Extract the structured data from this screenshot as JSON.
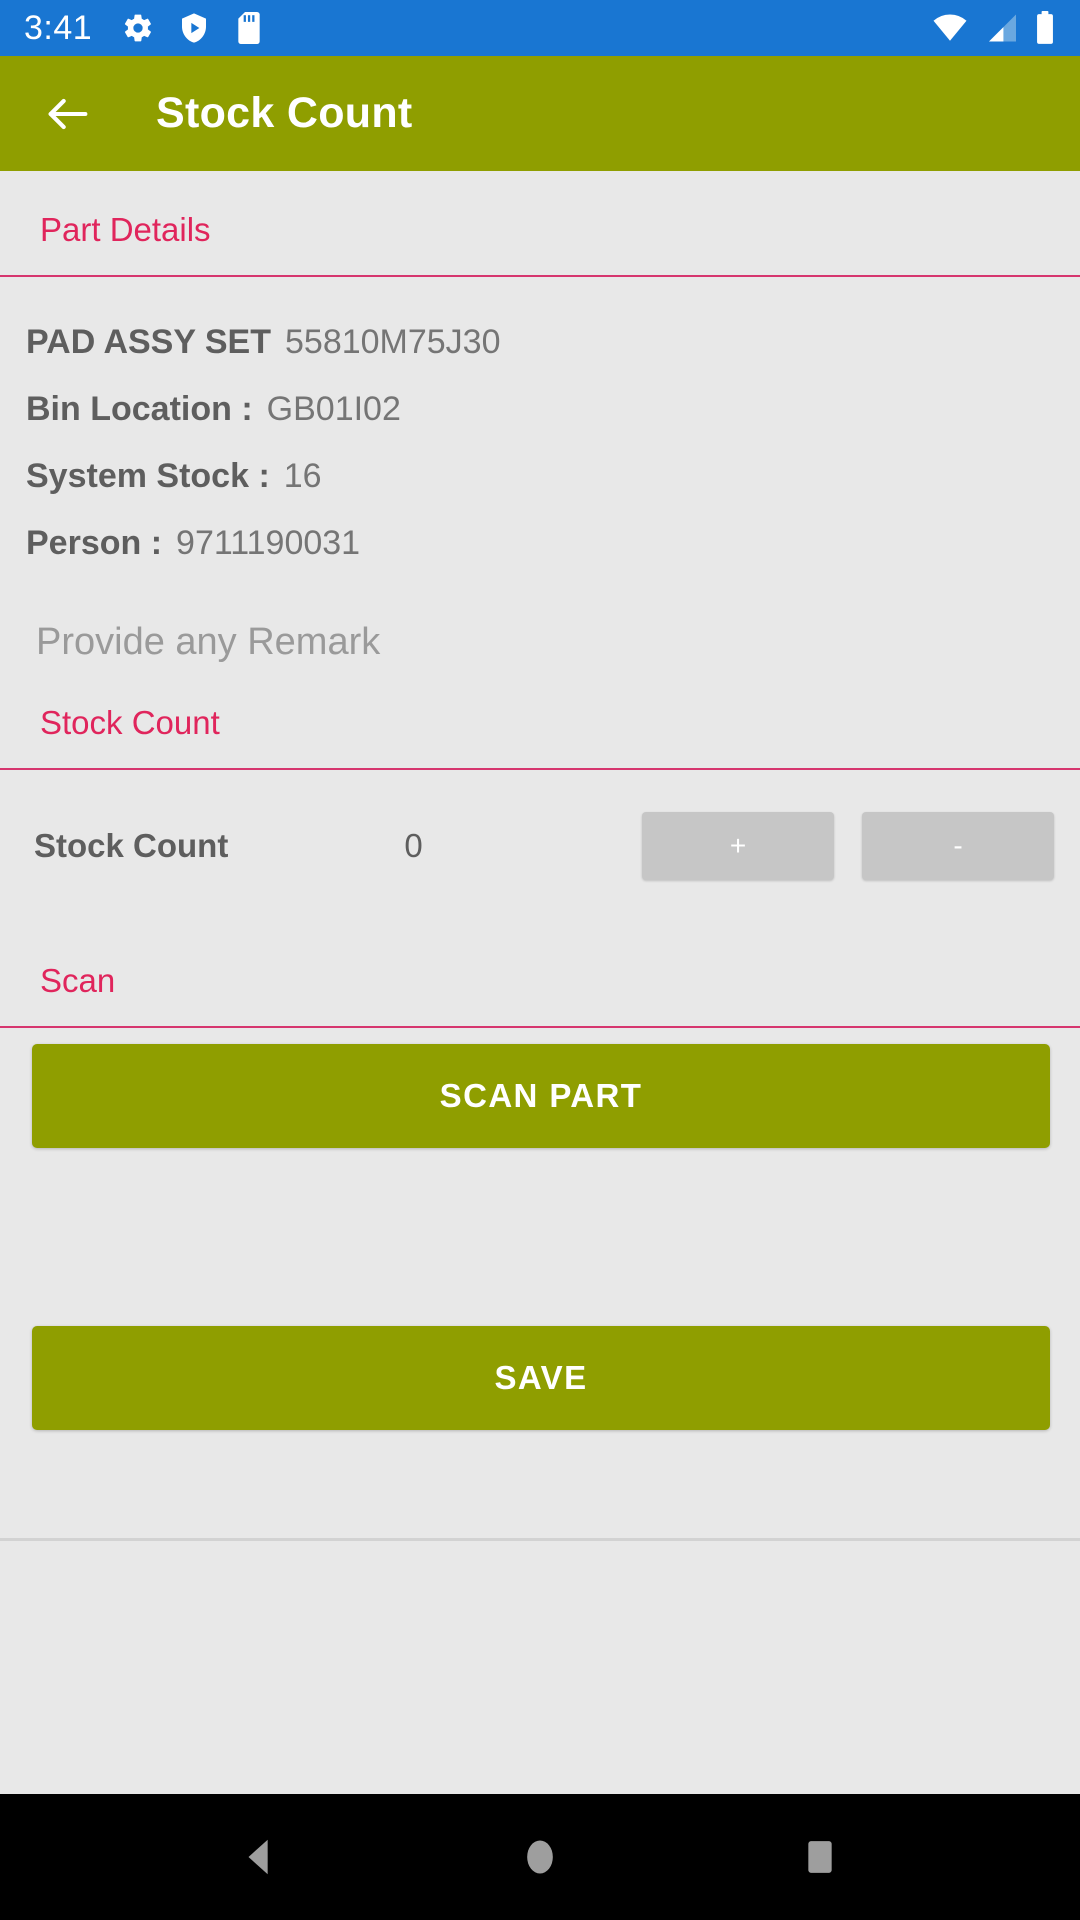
{
  "status_bar": {
    "time": "3:41",
    "background": "#1976d2",
    "left_icons": [
      "gear-icon",
      "shield-play-icon",
      "sd-card-icon"
    ],
    "right_icons": [
      "wifi-icon",
      "cell-signal-icon",
      "battery-icon"
    ]
  },
  "app_bar": {
    "back_label": "back-arrow",
    "title": "Stock Count",
    "background": "#8f9e00"
  },
  "accent": {
    "pink": "#e0255c",
    "olive": "#8f9e00",
    "blue": "#1976d2"
  },
  "part_details": {
    "section_title": "Part Details",
    "rows": [
      {
        "label": "PAD ASSY SET",
        "value": "55810M75J30"
      },
      {
        "label": "Bin Location :",
        "value": "GB01I02"
      },
      {
        "label": "System Stock :",
        "value": "16"
      },
      {
        "label": "Person :",
        "value": "9711190031"
      }
    ]
  },
  "remark": {
    "placeholder": "Provide any Remark",
    "value": ""
  },
  "stock_count": {
    "section_title": "Stock Count",
    "row_label": "Stock Count",
    "value": "0",
    "increment_label": "+",
    "decrement_label": "-"
  },
  "scan": {
    "section_title": "Scan",
    "scan_button_label": "SCAN PART"
  },
  "save": {
    "button_label": "SAVE"
  },
  "nav_bar": {
    "back": "nav-back",
    "home": "nav-home",
    "recents": "nav-recents"
  }
}
